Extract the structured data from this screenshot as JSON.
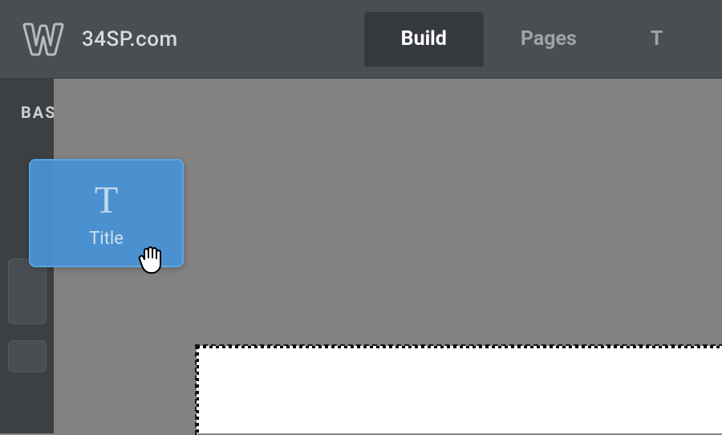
{
  "header": {
    "site_name": "34SP.com",
    "tabs": {
      "build": "Build",
      "pages": "Pages",
      "theme_partial": "T"
    },
    "active_tab": "build"
  },
  "sidebar": {
    "section_title": "BAS"
  },
  "drag_element": {
    "icon": "T",
    "label": "Title"
  }
}
